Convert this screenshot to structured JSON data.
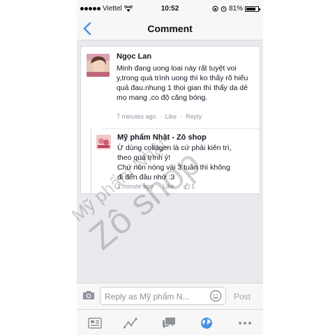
{
  "status_bar": {
    "carrier": "Viettel",
    "time": "10:52",
    "battery": "81%",
    "battery_level": 0.81
  },
  "nav": {
    "title": "Comment"
  },
  "comments": [
    {
      "author": "Ngọc Lan",
      "text": "Minh đang uong loai này rất tuyệt voi y,trong quá trình uong thì ko thấy rõ hiếu quả đau.nhung 1 thoi gian thì thấy da dẻ mọ mang ,co độ căng bóng.",
      "time": "7 minutes ago",
      "like_label": "Like",
      "reply_label": "Reply"
    },
    {
      "author": "Mỹ phẩm Nhật - Zô shop",
      "text_lines": [
        "Ừ dùng collagen là cứ phải kiên trì,",
        "theo quá trình ý!",
        "Chứ nôn nóng vài 3 tuần thì không",
        "đi đến đâu nhớ :3"
      ],
      "time": "1 minute ago",
      "like_label": "Like",
      "like_count": "1"
    }
  ],
  "watermark": {
    "line1": "Mỹ phẩm Nhật",
    "line2": "Zô shop"
  },
  "reply_bar": {
    "placeholder": "Reply as Mỹ phẩm N...",
    "post_label": "Post"
  },
  "tabs": [
    "news-feed-icon",
    "activity-icon",
    "messages-icon",
    "globe-icon",
    "more-icon"
  ],
  "colors": {
    "accent": "#4a90e2",
    "meta": "#9197a3",
    "background": "#e9eaed"
  }
}
